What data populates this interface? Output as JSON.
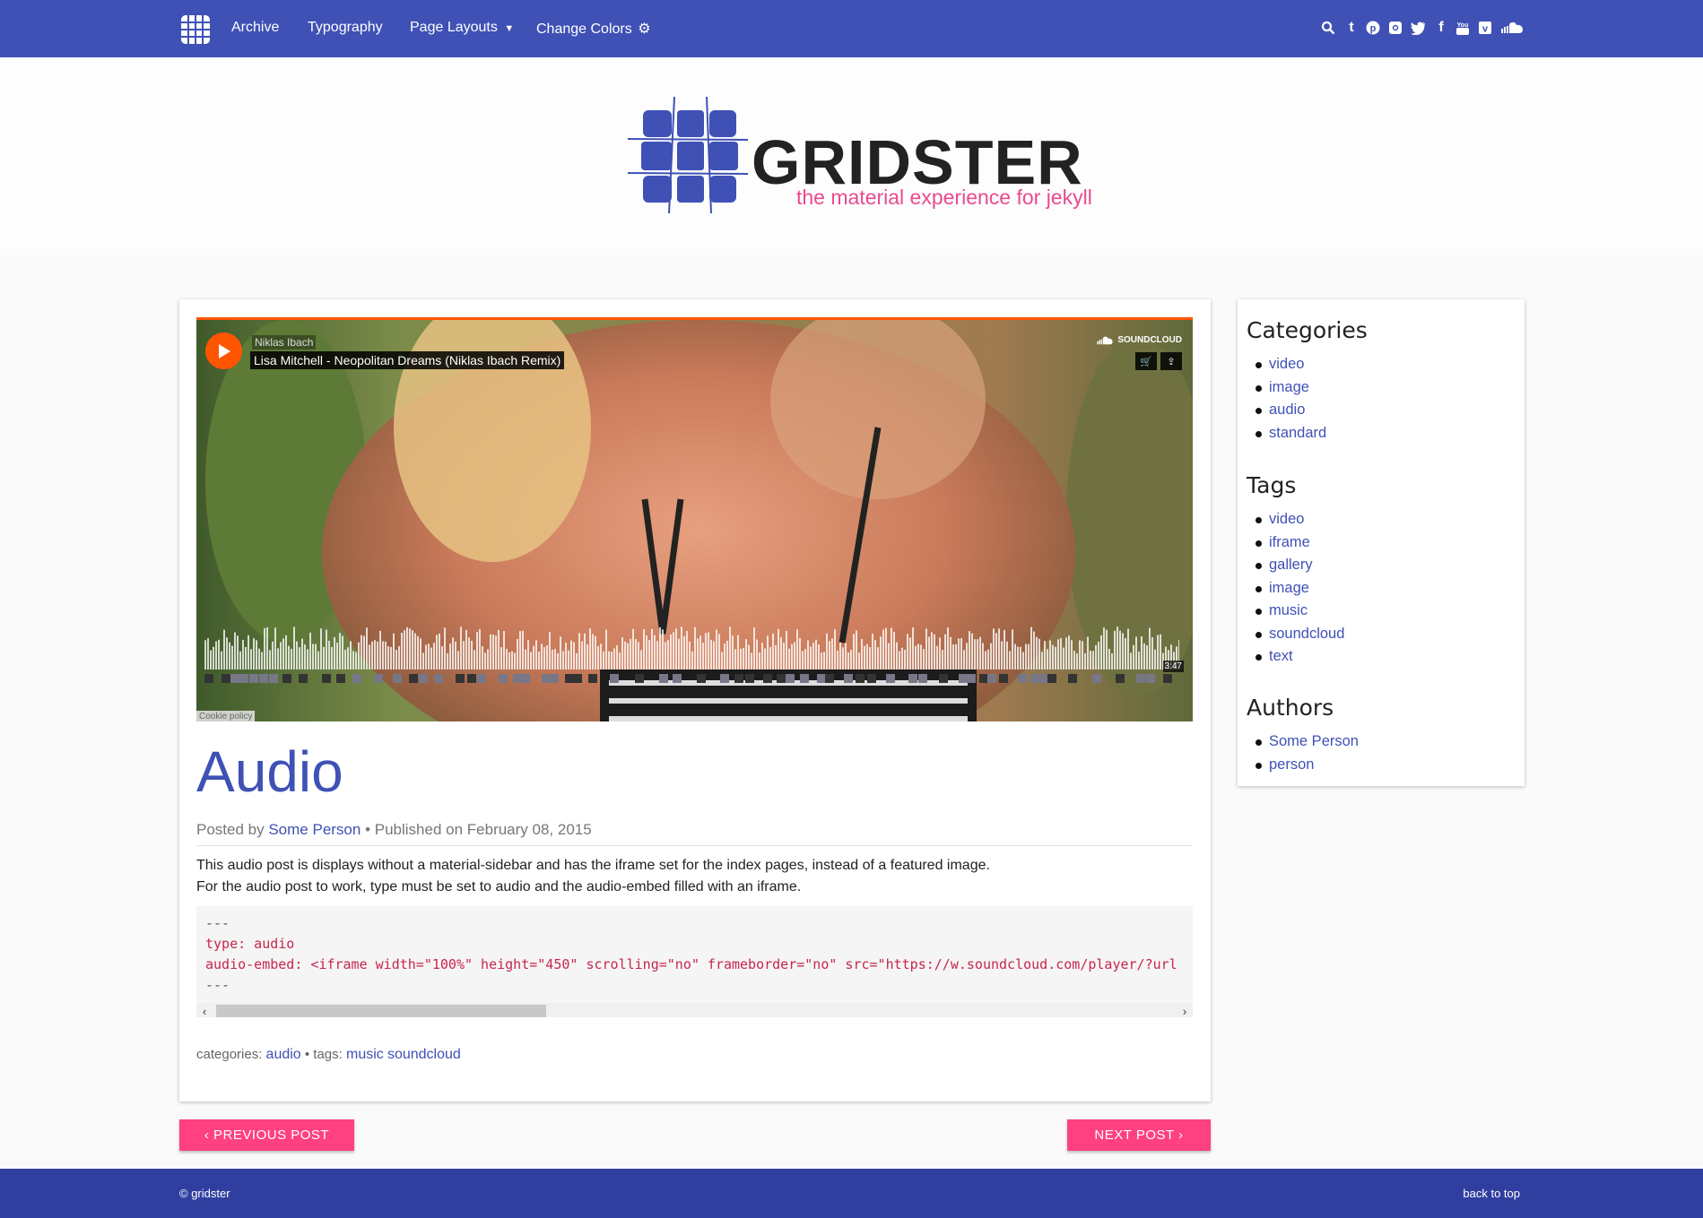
{
  "navbar": {
    "links": [
      "Archive",
      "Typography",
      "Page Layouts",
      "Change Colors"
    ],
    "social_icons": [
      "search-icon",
      "tumblr-icon",
      "pinterest-icon",
      "instagram-icon",
      "twitter-icon",
      "facebook-icon",
      "youtube-icon",
      "vimeo-icon",
      "soundcloud-icon"
    ]
  },
  "header": {
    "brand_name": "GRIDSTER",
    "tagline": "the material experience for jekyll"
  },
  "player": {
    "artist": "Niklas Ibach",
    "track": "Lisa Mitchell - Neopolitan Dreams (Niklas Ibach Remix)",
    "brand": "SOUNDCLOUD",
    "duration": "3:47",
    "cookie": "Cookie policy"
  },
  "post": {
    "title": "Audio",
    "meta_prefix": "Posted by",
    "author": "Some Person",
    "meta_published": "• Published on February 08, 2015",
    "body_line1": "This audio post is displays without a material-sidebar and has the iframe set for the index pages, instead of a featured image.",
    "body_line2": "For the audio post to work, type must be set to audio and the audio-embed filled with an iframe.",
    "code": {
      "line1": "---",
      "line2": "type: audio",
      "line3": "audio-embed: <iframe width=\"100%\" height=\"450\" scrolling=\"no\" frameborder=\"no\" src=\"https://w.soundcloud.com/player/?url",
      "line4": "---"
    },
    "footer_categories_label": "categories:",
    "footer_category": "audio",
    "footer_tags_label": "• tags:",
    "footer_tags": [
      "music",
      "soundcloud"
    ]
  },
  "sidebar": {
    "categories_heading": "Categories",
    "categories": [
      "video",
      "image",
      "audio",
      "standard"
    ],
    "tags_heading": "Tags",
    "tags": [
      "video",
      "iframe",
      "gallery",
      "image",
      "music",
      "soundcloud",
      "text"
    ],
    "authors_heading": "Authors",
    "authors": [
      "Some Person",
      "person"
    ]
  },
  "pager": {
    "previous": "‹ PREVIOUS POST",
    "next": "NEXT POST ›"
  },
  "footer": {
    "copyright": "© gridster",
    "back_to_top": "back to top"
  },
  "colors": {
    "primary": "#3f51b5",
    "accent": "#ff4081",
    "tagline": "#e94a8f",
    "soundcloud": "#ff5500",
    "footer": "#303f9f"
  }
}
